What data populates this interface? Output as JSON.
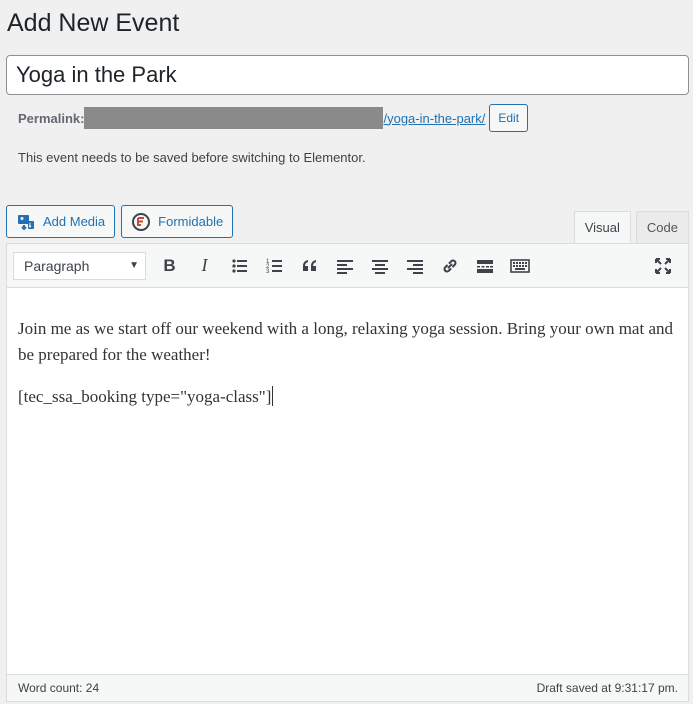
{
  "page": {
    "title": "Add New Event"
  },
  "post": {
    "title_value": "Yoga in the Park"
  },
  "permalink": {
    "label": "Permalink:",
    "slug": "/yoga-in-the-park/",
    "edit_label": "Edit"
  },
  "notice": "This event needs to be saved before switching to Elementor.",
  "media_buttons": {
    "add_media": "Add Media",
    "formidable": "Formidable"
  },
  "tabs": {
    "visual": "Visual",
    "code": "Code"
  },
  "toolbar": {
    "format_value": "Paragraph",
    "buttons": [
      "bold-icon",
      "italic-icon",
      "bullet-list-icon",
      "numbered-list-icon",
      "blockquote-icon",
      "align-left-icon",
      "align-center-icon",
      "align-right-icon",
      "link-icon",
      "read-more-icon",
      "toolbar-toggle-icon",
      "fullscreen-icon"
    ]
  },
  "content": {
    "paragraph": "Join me as we start off our weekend with a long, relaxing yoga session. Bring your own mat and be prepared for the weather!",
    "shortcode": "[tec_ssa_booking type=\"yoga-class\"]"
  },
  "status": {
    "word_count": "Word count: 24",
    "draft_saved": "Draft saved at 9:31:17 pm."
  },
  "colors": {
    "accent": "#2271b1",
    "background": "#f0f0f1",
    "redacted": "#8a8a8a"
  }
}
